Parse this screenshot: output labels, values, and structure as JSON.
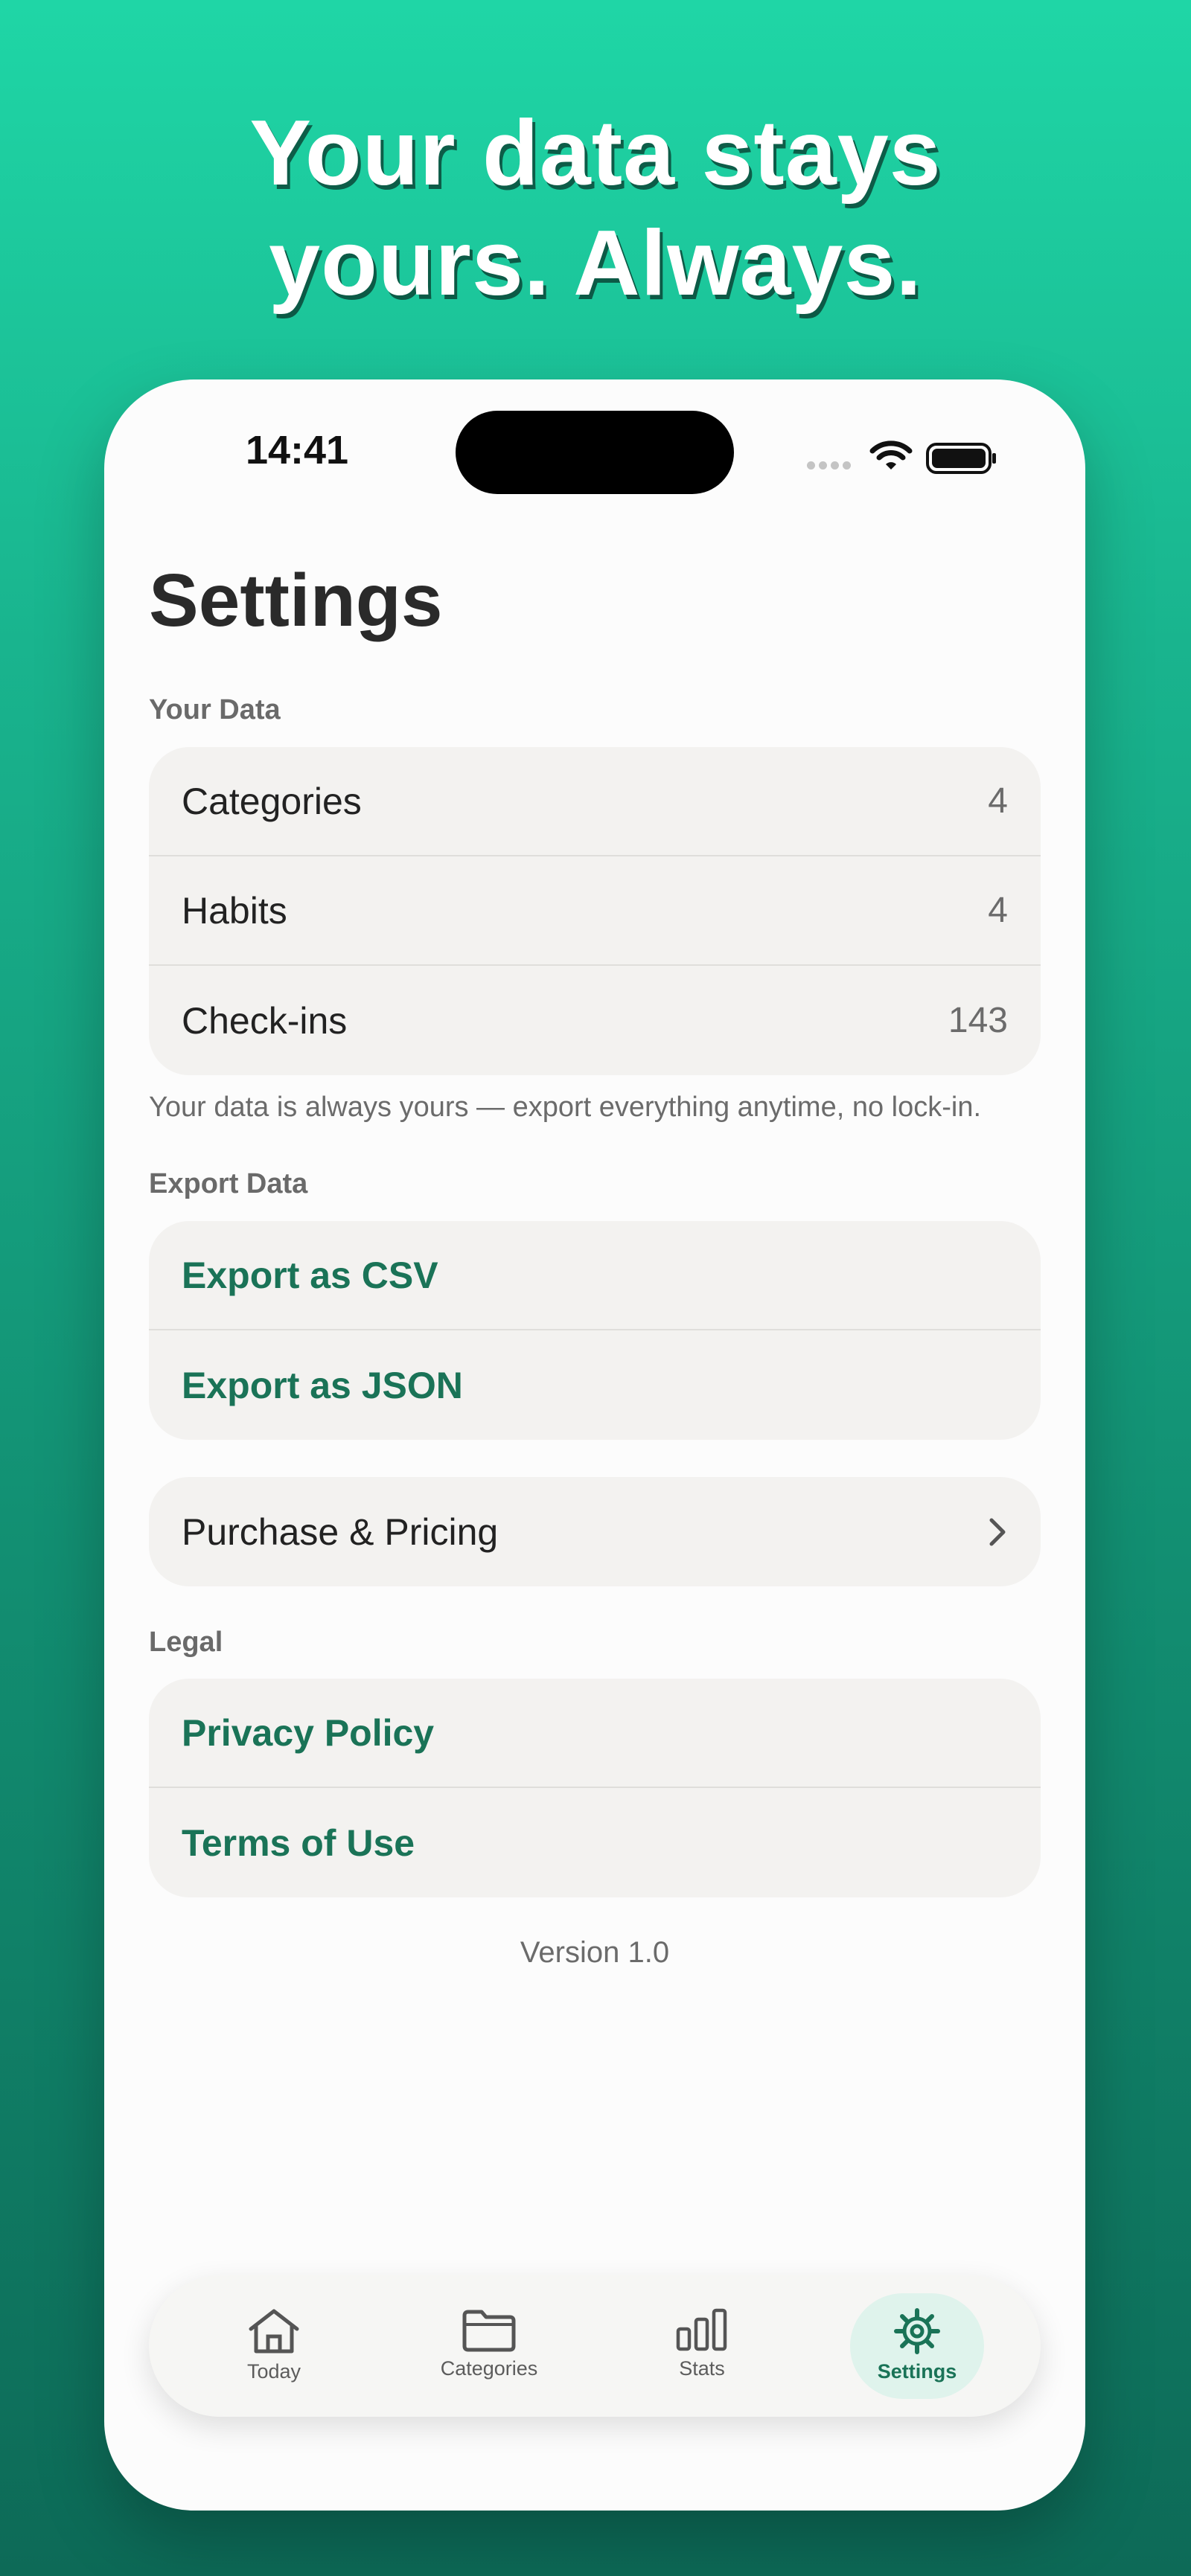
{
  "headline": {
    "line1": "Your data stays",
    "line2": "yours. Always."
  },
  "status_bar": {
    "time": "14:41"
  },
  "page": {
    "title": "Settings"
  },
  "your_data": {
    "label": "Your Data",
    "rows": [
      {
        "label": "Categories",
        "value": "4"
      },
      {
        "label": "Habits",
        "value": "4"
      },
      {
        "label": "Check-ins",
        "value": "143"
      }
    ],
    "footnote": "Your data is always yours — export everything anytime, no lock-in."
  },
  "export_data": {
    "label": "Export Data",
    "rows": [
      {
        "label": "Export as CSV"
      },
      {
        "label": "Export as JSON"
      }
    ]
  },
  "purchase": {
    "label": "Purchase & Pricing"
  },
  "legal": {
    "label": "Legal",
    "rows": [
      {
        "label": "Privacy Policy"
      },
      {
        "label": "Terms of Use"
      }
    ]
  },
  "version": "Version 1.0",
  "tab_bar": {
    "tabs": [
      {
        "label": "Today",
        "icon": "house-icon",
        "active": false
      },
      {
        "label": "Categories",
        "icon": "folder-icon",
        "active": false
      },
      {
        "label": "Stats",
        "icon": "bar-chart-icon",
        "active": false
      },
      {
        "label": "Settings",
        "icon": "gear-icon",
        "active": true
      }
    ]
  },
  "colors": {
    "accent": "#1a7357",
    "background_top": "#1fd6a6",
    "background_bottom": "#0d6a57"
  }
}
